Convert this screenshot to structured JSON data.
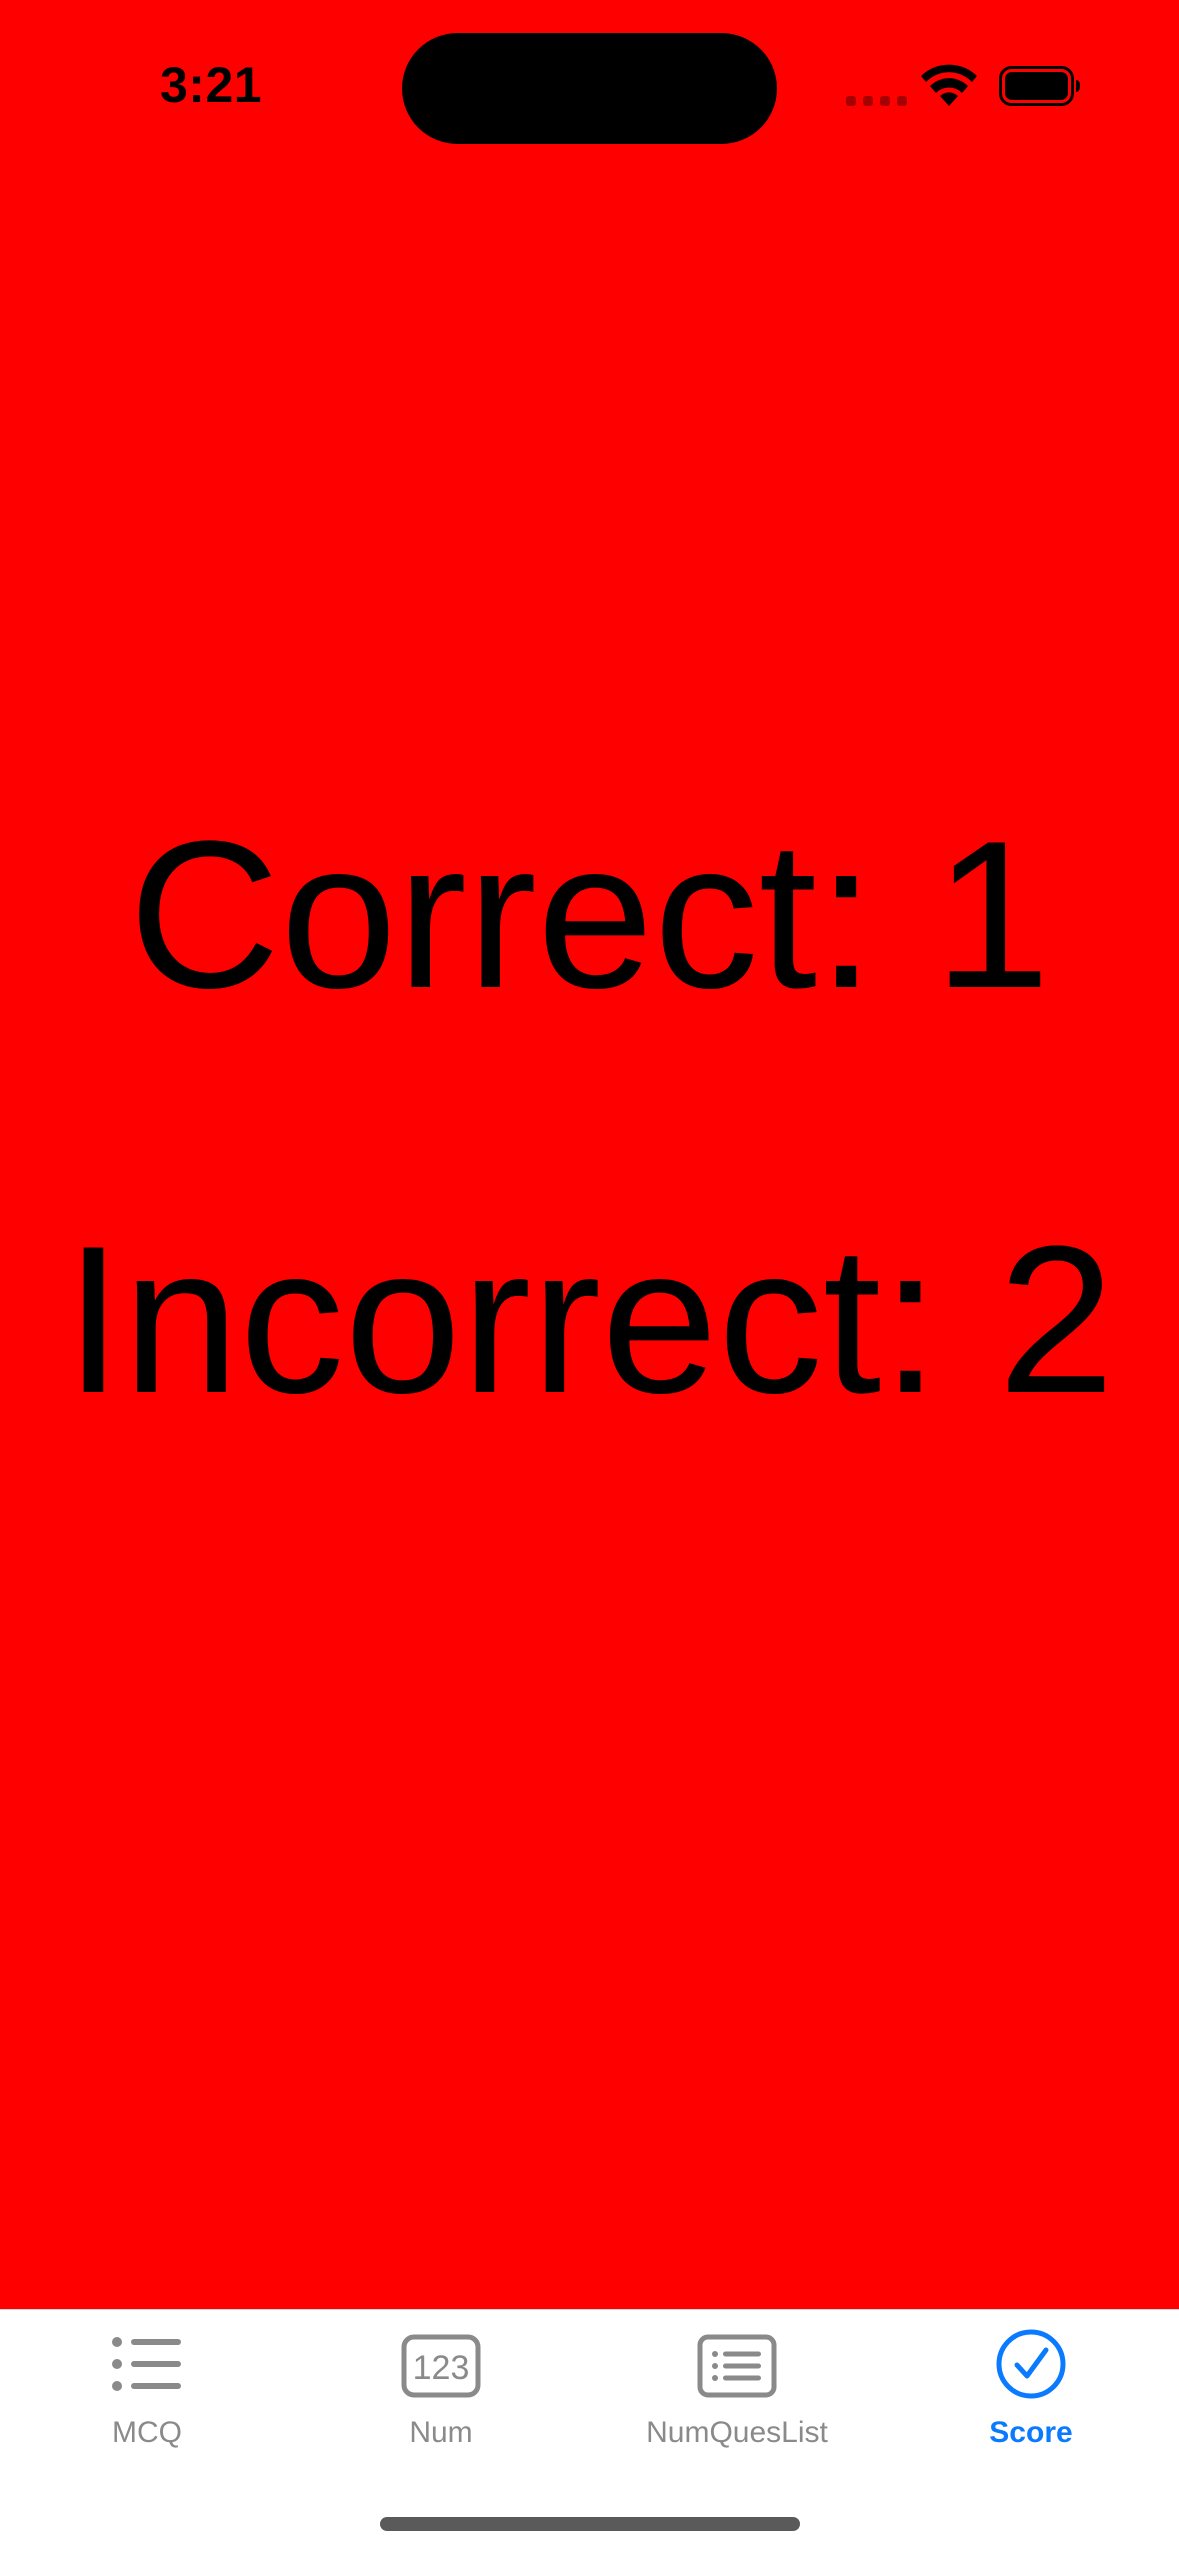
{
  "status_bar": {
    "time": "3:21"
  },
  "score": {
    "correct_text": "Correct: 1",
    "incorrect_text": "Incorrect: 2"
  },
  "colors": {
    "background": "#FF0000",
    "tab_active": "#0A7AFF",
    "tab_inactive": "#8A8A8A"
  },
  "tab_bar": {
    "tabs": [
      {
        "label": "MCQ",
        "icon": "list-bullet-icon",
        "active": false
      },
      {
        "label": "Num",
        "icon": "number-123-icon",
        "active": false
      },
      {
        "label": "NumQuesList",
        "icon": "list-rectangle-icon",
        "active": false
      },
      {
        "label": "Score",
        "icon": "checkmark-circle-icon",
        "active": true
      }
    ]
  }
}
